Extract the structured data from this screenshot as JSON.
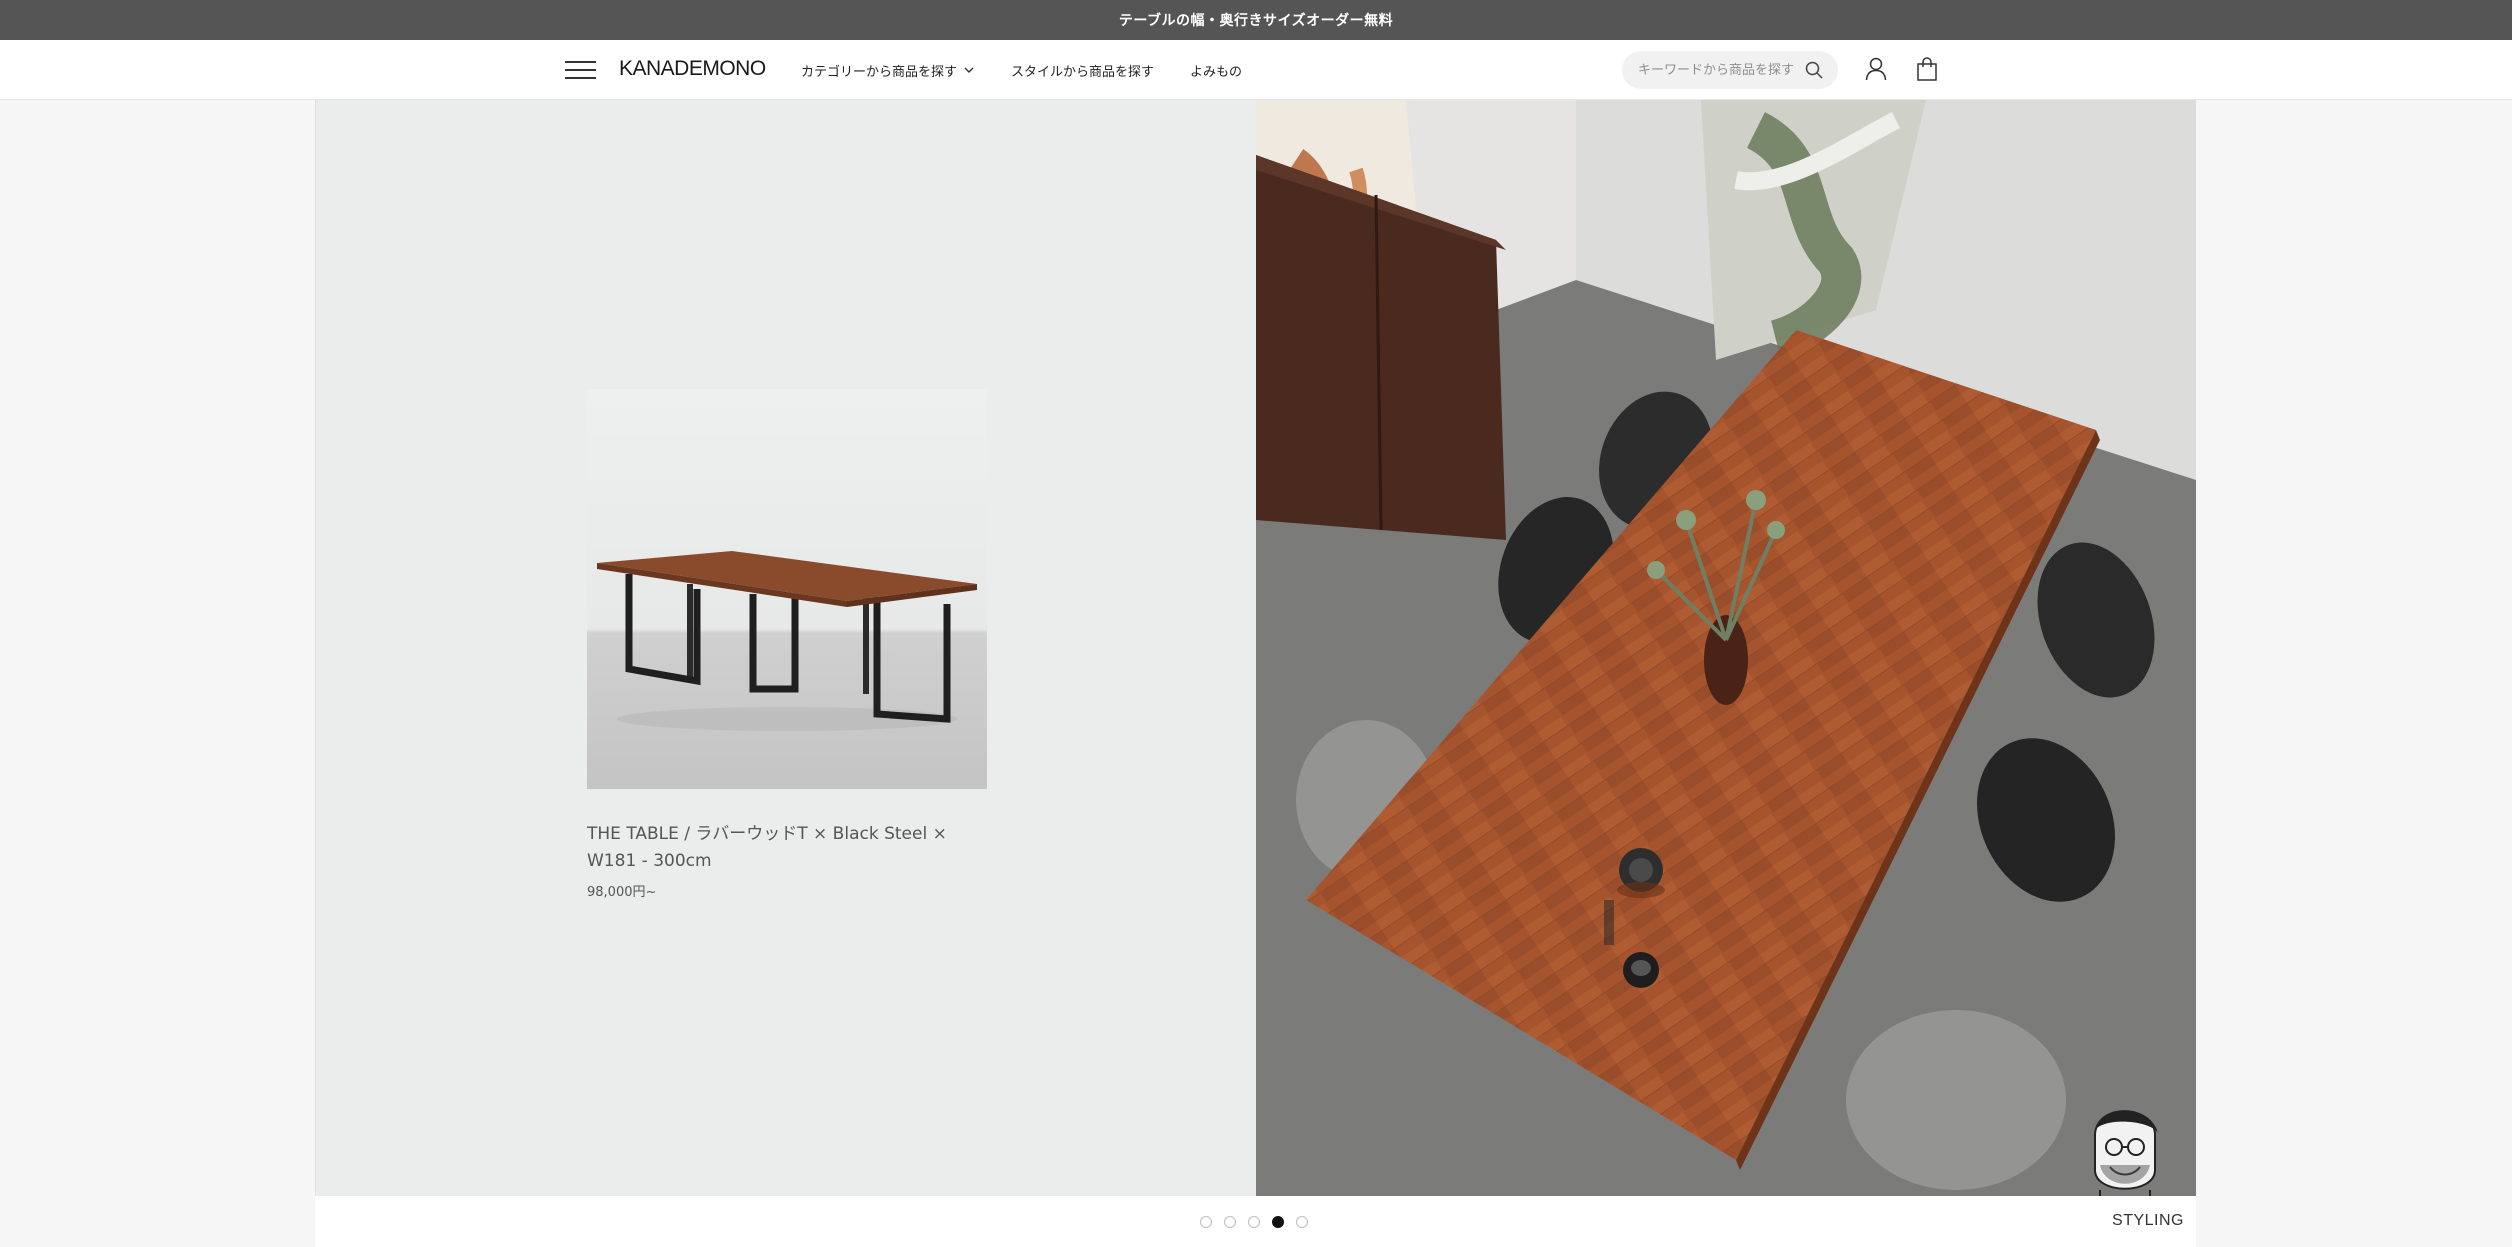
{
  "announcement": {
    "text": "テーブルの幅・奥行きサイズオーダー無料"
  },
  "header": {
    "logo": "KANADEMONO",
    "nav": [
      {
        "label": "カテゴリーから商品を探す",
        "has_dropdown": true
      },
      {
        "label": "スタイルから商品を探す",
        "has_dropdown": false
      },
      {
        "label": "よみもの",
        "has_dropdown": false
      }
    ],
    "search": {
      "placeholder": "キーワードから商品を探す",
      "value": ""
    },
    "icons": [
      "menu-icon",
      "search-icon",
      "account-icon",
      "cart-icon"
    ]
  },
  "product": {
    "name": "THE TABLE / ラバーウッドT × Black Steel × W181 - 300cm",
    "price": "98,000円~"
  },
  "carousel": {
    "total_slides": 5,
    "active_index": 3,
    "section_label": "STYLING"
  },
  "colors": {
    "announcement_bg": "#555555",
    "panel_bg": "#ebecec",
    "table_wood": "#a5542e",
    "accent_dark": "#111111"
  }
}
